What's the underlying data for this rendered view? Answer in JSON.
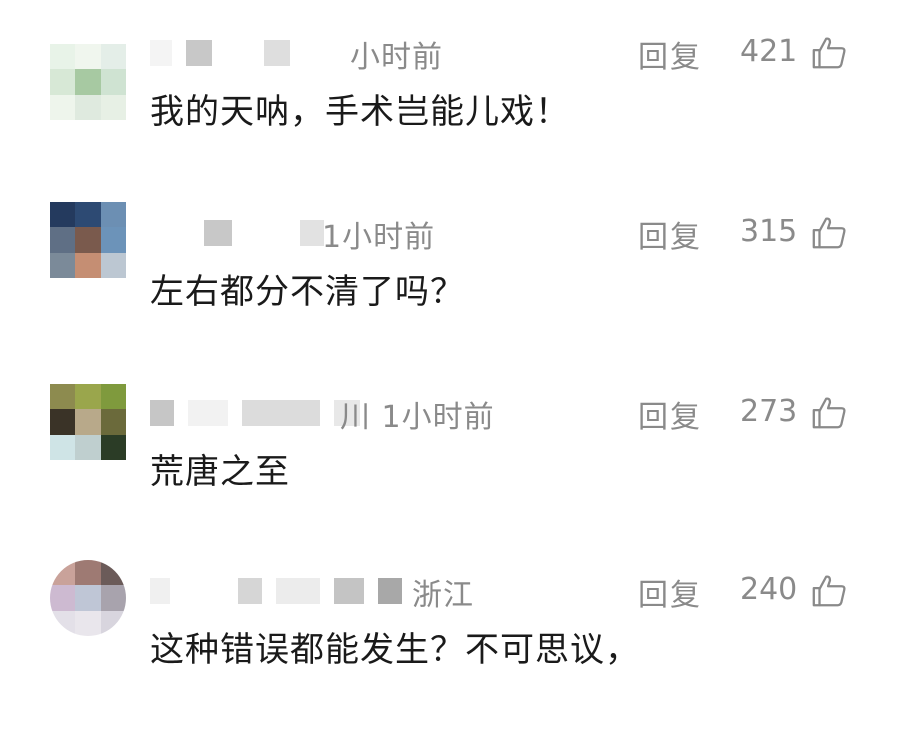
{
  "comments": [
    {
      "meta": "小时前",
      "reply_label": "回复",
      "likes": "421",
      "text": "我的天呐，手术岂能儿戏！",
      "avatar_colors": [
        "#e8f3e8",
        "#f0f6ee",
        "#e4eee8",
        "#d7e8d6",
        "#a7c9a2",
        "#cfe3d2",
        "#eef5ec",
        "#dfeadf",
        "#e7f0e5"
      ]
    },
    {
      "meta": "1小时前",
      "reply_label": "回复",
      "likes": "315",
      "text": "左右都分不清了吗？",
      "avatar_colors": [
        "#243a5e",
        "#2d4a73",
        "#6c8fb3",
        "#5f6f85",
        "#7a5a4d",
        "#6c93b9",
        "#7b8a99",
        "#c58e73",
        "#bcc7d2"
      ]
    },
    {
      "meta": "川 1小时前",
      "reply_label": "回复",
      "likes": "273",
      "text": "荒唐之至",
      "avatar_colors": [
        "#8d8b4f",
        "#9aa64c",
        "#7f9a3d",
        "#3a3327",
        "#b8a98a",
        "#6b6a3b",
        "#cfe4e6",
        "#bfcfcf",
        "#2b3c26"
      ]
    },
    {
      "meta": "浙江",
      "reply_label": "回复",
      "likes": "240",
      "text": "这种错误都能发生？不可思议，",
      "avatar_colors": [
        "#c9a29a",
        "#9e7a73",
        "#6b5b59",
        "#cdbad1",
        "#bfc6d6",
        "#a8a3ad",
        "#e3e0e8",
        "#e9e6ec",
        "#d8d5de"
      ]
    }
  ]
}
